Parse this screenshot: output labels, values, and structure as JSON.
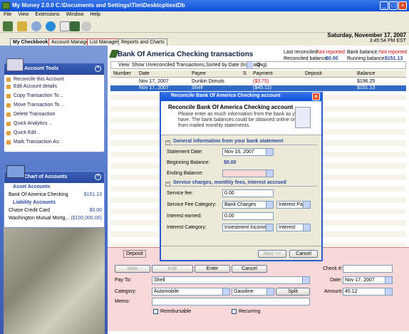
{
  "window": {
    "title": "My Money 2.0.0 C:\\Documents and Settings\\Tim\\Desktop\\testDb"
  },
  "menu": [
    "File",
    "View",
    "Extensions",
    "Window",
    "Help"
  ],
  "date": {
    "long": "Saturday, November 17, 2007",
    "time": "3:45:54 PM EST"
  },
  "tabs": [
    "My Checkbook",
    "Account Manager",
    "List Manager",
    "Reports and Charts"
  ],
  "account_tools": {
    "title": "Account Tools",
    "items": [
      "Reconcile this Account",
      "Edit Account details",
      "Copy Transaction To ..",
      "Move Transaction To ..",
      "Delete Transaction",
      "Quick Analytics ..",
      "Quick Edit ..",
      "Mark Transaction As:"
    ]
  },
  "chart_of_accounts": {
    "title": "Chart of Accounts",
    "asset_header": "Asset Accounts",
    "assets": [
      {
        "name": "Bank Of America Checking",
        "amount": "$151.13"
      }
    ],
    "liability_header": "Liability Accounts",
    "liabilities": [
      {
        "name": "Chase Credit Card",
        "amount": "$0.00"
      },
      {
        "name": "Washington Mutual Mortg...",
        "amount": "($100,000.00)"
      }
    ]
  },
  "account": {
    "title": "Bank Of America Checking transactions",
    "last_reconciled_label": "Last reconciled:",
    "last_reconciled": "Not reported",
    "reconciled_balance_label": "Reconciled balance:",
    "reconciled_balance": "$0.00",
    "bank_balance_label": "Bank balance:",
    "bank_balance": "Not reported",
    "running_balance_label": "Running balance:",
    "running_balance": "$151.13"
  },
  "view": {
    "label": "View: Show Unreconciled Transactions,Sorted by Date (Increasing)"
  },
  "columns": [
    "Number",
    "Date",
    "Payee",
    "S",
    "Payment",
    "Deposit",
    "Balance"
  ],
  "rows": [
    {
      "number": "",
      "date": "Nov 17, 2007",
      "payee": "Dunkin Donuts",
      "s": "",
      "payment": "($3.75)",
      "deposit": "",
      "balance": "$196.25"
    },
    {
      "number": "",
      "date": "Nov 17, 2007",
      "payee": "Shell",
      "s": "",
      "payment": "($45.12)",
      "deposit": "",
      "balance": "$151.13"
    }
  ],
  "entry": {
    "tabs": [
      "Deposit"
    ],
    "buttons": {
      "new": "New",
      "edit": "Edit",
      "enter": "Enter",
      "cancel": "Cancel",
      "split": "Split"
    },
    "check_label": "Check #:",
    "check_value": "",
    "pay_to_label": "Pay To:",
    "pay_to": "Shell",
    "date_label": "Date:",
    "date": "Nov 17, 2007",
    "category_label": "Category:",
    "category": "Automobile",
    "subcategory": "Gasoline",
    "amount_label": "Amount:",
    "amount": "45.12",
    "memo_label": "Memo:",
    "memo": "",
    "reimbursable": "Reimbursable",
    "recurring": "Recurring"
  },
  "dialog": {
    "title": "Reconcile Bank Of America Checking account",
    "heading": "Reconcile Bank Of America Checking account",
    "description": [
      "Please enter as much information from the bank as you",
      "have. The bank balances could be obtained online or",
      "from mailed monthly statements."
    ],
    "section1": "General information from your bank statement",
    "statement_date_label": "Statement Date:",
    "statement_date": "Nov 16, 2007",
    "beginning_balance_label": "Beginning Balance:",
    "beginning_balance": "$0.00",
    "ending_balance_label": "Ending Balance:",
    "ending_balance": "",
    "section2": "Service charges, monthly fees, interest accrued",
    "service_fee_label": "Service fee:",
    "service_fee": "0.00",
    "service_fee_category_label": "Service Fee Category:",
    "service_fee_category": "Bank Charges",
    "service_fee_subcategory": "Interest Paid",
    "interest_earned_label": "Interest earned:",
    "interest_earned": "0.00",
    "interest_category_label": "Interest Category:",
    "interest_category": "Investment Income",
    "interest_subcategory": "Interest",
    "next_button": "Next >>",
    "cancel_button": "Cancel"
  },
  "colors": {
    "selected_row": "#316ac5",
    "negative": "#cc0000",
    "link": "#2a4aa0"
  }
}
